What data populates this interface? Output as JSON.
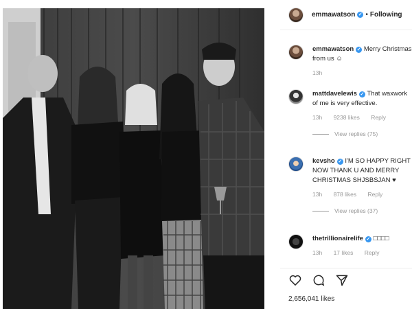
{
  "post": {
    "author": "emmawatson",
    "follow_status": "Following",
    "separator": "•"
  },
  "comments": [
    {
      "username": "emmawatson",
      "verified": true,
      "text": "Merry Christmas from us ☺",
      "time": "13h",
      "likes": "",
      "reply": "",
      "view_replies": ""
    },
    {
      "username": "mattdavelewis",
      "verified": true,
      "text": "That waxwork of me is very effective.",
      "time": "13h",
      "likes": "9238 likes",
      "reply": "Reply",
      "view_replies": "View replies (75)"
    },
    {
      "username": "kevsho",
      "verified": true,
      "text": "I'M SO HAPPY RIGHT NOW THANK U AND MERRY CHRISTMAS SHJSBSJAN ♥",
      "time": "13h",
      "likes": "878 likes",
      "reply": "Reply",
      "view_replies": "View replies (37)"
    },
    {
      "username": "thetrillionairelife",
      "verified": true,
      "text": "□□□□",
      "time": "13h",
      "likes": "17 likes",
      "reply": "Reply",
      "view_replies": ""
    }
  ],
  "actions": {
    "like_icon": "heart-icon",
    "comment_icon": "comment-icon",
    "share_icon": "share-icon"
  },
  "likes_count": "2,656,041 likes",
  "colors": {
    "verified": "#3897f0",
    "meta": "#999999",
    "text": "#262626"
  }
}
